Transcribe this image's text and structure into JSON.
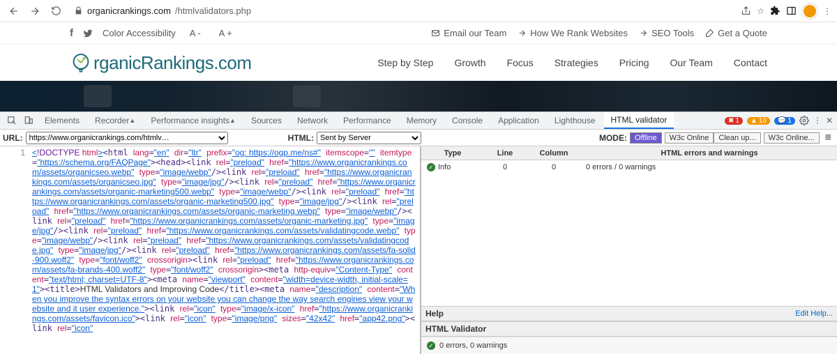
{
  "browser": {
    "url_host": "organicrankings.com",
    "url_path": "/htmlvalidators.php"
  },
  "utility": {
    "color_access": "Color Accessibility",
    "zoom_out": "A -",
    "zoom_in": "A +",
    "email": "Email our Team",
    "how_rank": "How We Rank Websites",
    "seo_tools": "SEO Tools",
    "quote": "Get a Quote"
  },
  "logo_text": "rganicRankings.com",
  "nav": {
    "step": "Step by Step",
    "growth": "Growth",
    "focus": "Focus",
    "strategies": "Strategies",
    "pricing": "Pricing",
    "team": "Our Team",
    "contact": "Contact"
  },
  "devtools": {
    "tabs": {
      "elements": "Elements",
      "recorder": "Recorder",
      "perf_insights": "Performance insights",
      "sources": "Sources",
      "network": "Network",
      "performance": "Performance",
      "memory": "Memory",
      "console": "Console",
      "application": "Application",
      "lighthouse": "Lighthouse",
      "html_validator": "HTML validator"
    },
    "err": "1",
    "warn": "10",
    "info": "1"
  },
  "validator_tb": {
    "url_label": "URL:",
    "url_value": "https://www.organicrankings.com/htmlv…",
    "html_label": "HTML:",
    "html_value": "Sent by Server",
    "mode_label": "MODE:",
    "mode_offline": "Offline",
    "mode_w3c": "W3c Online",
    "cleanup": "Clean up...",
    "w3c_btn": "W3c Online..."
  },
  "code_line_no": "1",
  "code_html": "<span class='t-blue'>&lt;</span><span class='t-purple'>!DOCTYPE </span><span class='t-red'>html</span><span class='t-blue'>&gt;</span>&lt;html <span class='t-red'>lang</span>=<span class='t-blue'>\"en\"</span> <span class='t-red'>dir</span>=<span class='t-blue'>\"ltr\"</span> <span class='t-red'>prefix</span>=<span class='t-blue'>\"og: https://ogp.me/ns#\"</span> <span class='t-red'>itemscope</span>=<span class='t-blue'>\"\"</span> <span class='t-red'>itemtype</span>=<span class='t-blue'>\"https://schema.org/FAQPage\"</span>&gt;&lt;head&gt;&lt;link <span class='t-red'>rel</span>=<span class='t-blue'>\"preload\"</span> <span class='t-red'>href</span>=<span class='t-blue'>\"https://www.organicrankings.com/assets/organicseo.webp\"</span> <span class='t-red'>type</span>=<span class='t-blue'>\"image/webp\"</span>/&gt;&lt;link <span class='t-red'>rel</span>=<span class='t-blue'>\"preload\"</span> <span class='t-red'>href</span>=<span class='t-blue'>\"https://www.organicrankings.com/assets/organicseo.jpg\"</span> <span class='t-red'>type</span>=<span class='t-blue'>\"image/jpg\"</span>/&gt;&lt;link <span class='t-red'>rel</span>=<span class='t-blue'>\"preload\"</span> <span class='t-red'>href</span>=<span class='t-blue'>\"https://www.organicrankings.com/assets/organic-marketing500.webp\"</span> <span class='t-red'>type</span>=<span class='t-blue'>\"image/webp\"</span>/&gt;&lt;link <span class='t-red'>rel</span>=<span class='t-blue'>\"preload\"</span> <span class='t-red'>href</span>=<span class='t-blue'>\"https://www.organicrankings.com/assets/organic-marketing500.jpg\"</span> <span class='t-red'>type</span>=<span class='t-blue'>\"image/jpg\"</span>/&gt;&lt;link <span class='t-red'>rel</span>=<span class='t-blue'>\"preload\"</span> <span class='t-red'>href</span>=<span class='t-blue'>\"https://www.organicrankings.com/assets/organic-marketing.webp\"</span> <span class='t-red'>type</span>=<span class='t-blue'>\"image/webp\"</span>/&gt;&lt;link <span class='t-red'>rel</span>=<span class='t-blue'>\"preload\"</span> <span class='t-red'>href</span>=<span class='t-blue'>\"https://www.organicrankings.com/assets/organic-marketing.jpg\"</span> <span class='t-red'>type</span>=<span class='t-blue'>\"image/jpg\"</span>/&gt;&lt;link <span class='t-red'>rel</span>=<span class='t-blue'>\"preload\"</span> <span class='t-red'>href</span>=<span class='t-blue'>\"https://www.organicrankings.com/assets/validatingcode.webp\"</span> <span class='t-red'>type</span>=<span class='t-blue'>\"image/webp\"</span>/&gt;&lt;link <span class='t-red'>rel</span>=<span class='t-blue'>\"preload\"</span> <span class='t-red'>href</span>=<span class='t-blue'>\"https://www.organicrankings.com/assets/validatingcode.jpg\"</span> <span class='t-red'>type</span>=<span class='t-blue'>\"image/jpg\"</span>/&gt;&lt;link <span class='t-red'>rel</span>=<span class='t-blue'>\"preload\"</span> <span class='t-red'>href</span>=<span class='t-blue'>\"https://www.organicrankings.com/assets/fa-solid-900.woff2\"</span>  <span class='t-red'>type</span>=<span class='t-blue'>\"font/woff2\"</span> <span class='t-red'>crossorigin</span>&gt;&lt;link <span class='t-red'>rel</span>=<span class='t-blue'>\"preload\"</span> <span class='t-red'>href</span>=<span class='t-blue'>\"https://www.organicrankings.com/assets/fa-brands-400.woff2\"</span>  <span class='t-red'>type</span>=<span class='t-blue'>\"font/woff2\"</span> <span class='t-red'>crossorigin</span>&gt;&lt;meta <span class='t-red'>http-equiv</span>=<span class='t-blue'>\"Content-Type\"</span> <span class='t-red'>content</span>=<span class='t-blue'>\"text/html; charset=UTF-8\"</span>&gt;&lt;meta <span class='t-red'>name</span>=<span class='t-blue'>\"viewport\"</span> <span class='t-red'>content</span>=<span class='t-blue'>\"width=device-width, initial-scale=1\"</span>&gt;&lt;title&gt;<span class='t-black'>HTML Validators and Improving Code</span>&lt;/title&gt;&lt;meta <span class='t-red'>name</span>=<span class='t-blue'>\"description\"</span> <span class='t-red'>content</span>=<span class='t-blue'>\"When you improve the syntax errors on your website you can change the way search engines view your website and it user experience.\"</span>&gt;&lt;link <span class='t-red'>rel</span>=<span class='t-blue'>\"icon\"</span> <span class='t-red'>type</span>=<span class='t-blue'>\"image/x-icon\"</span> <span class='t-red'>href</span>=<span class='t-blue'>\"https://www.organicrankings.com/assets/favicon.ico\"</span>&gt;&lt;link <span class='t-red'>rel</span>=<span class='t-blue'>\"icon\"</span> <span class='t-red'>type</span>=<span class='t-blue'>\"image/png\"</span> <span class='t-red'>sizes</span>=<span class='t-blue'>\"42x42\"</span> <span class='t-red'>href</span>=<span class='t-blue'>\"app42.png\"</span>&gt;&lt;link <span class='t-red'>rel</span>=<span class='t-blue'>\"icon\"</span>",
  "results": {
    "head": {
      "type": "Type",
      "line": "Line",
      "column": "Column",
      "msg": "HTML errors and warnings"
    },
    "row": {
      "type": "Info",
      "line": "0",
      "column": "0",
      "msg": "0 errors / 0 warnings"
    },
    "help": "Help",
    "edit_help": "Edit Help...",
    "validator_title": "HTML Validator",
    "summary": "0 errors, 0 warnings"
  }
}
